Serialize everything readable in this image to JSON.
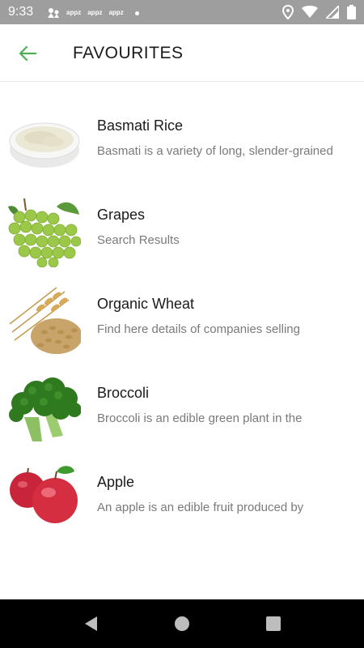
{
  "status_bar": {
    "time": "9:33",
    "notification_icons": [
      "app-notification-icon",
      "apps-notification-icon",
      "apps-notification-icon",
      "apps-notification-icon"
    ],
    "notification_labels": [
      "appz",
      "appz",
      "appz"
    ],
    "right_icons": [
      "location-icon",
      "wifi-icon",
      "signal-icon",
      "battery-icon"
    ],
    "background_color": "#9e9e9e"
  },
  "app_bar": {
    "title": "FAVOURITES",
    "back_icon": "arrow-back-icon",
    "accent_color": "#4caf50"
  },
  "favourites": [
    {
      "name": "Basmati Rice",
      "description": "Basmati is a variety of long, slender-grained",
      "image": "rice-bowl-image"
    },
    {
      "name": "Grapes",
      "description": "Search Results",
      "image": "grapes-image"
    },
    {
      "name": "Organic Wheat",
      "description": "Find here details of companies selling",
      "image": "wheat-image"
    },
    {
      "name": "Broccoli",
      "description": "Broccoli is an edible green plant in the",
      "image": "broccoli-image"
    },
    {
      "name": "Apple",
      "description": "An apple is an edible fruit produced by",
      "image": "apple-image"
    }
  ],
  "nav_bar": {
    "buttons": [
      "back-triangle-icon",
      "home-circle-icon",
      "recents-square-icon"
    ]
  }
}
